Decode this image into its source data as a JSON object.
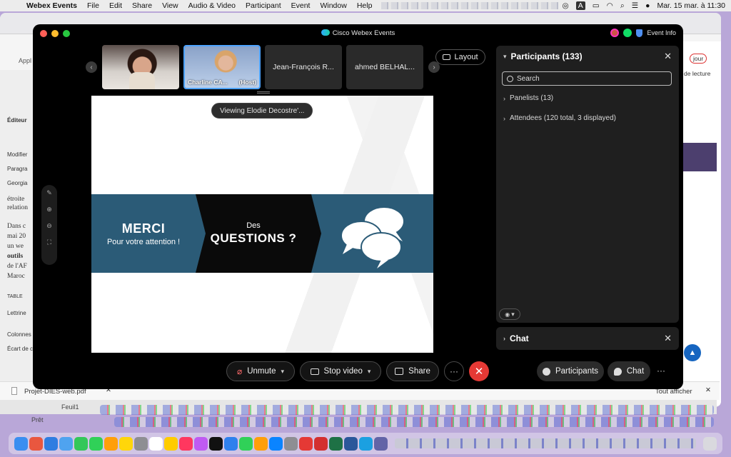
{
  "menubar": {
    "app": "Webex Events",
    "items": [
      "File",
      "Edit",
      "Share",
      "View",
      "Audio & Video",
      "Participant",
      "Event",
      "Window",
      "Help"
    ],
    "clock": "Mar. 15 mar. à 11:30",
    "letter_icon": "A"
  },
  "background": {
    "left_labels": [
      "Éditeur",
      "Modifier",
      "Paragra",
      "Georgia",
      "étroite",
      "relation",
      "Dans c",
      "mai 20",
      "un we",
      "outils",
      "de l'AF",
      "Maroc",
      "TABLE",
      "Lettrine",
      "Colonnes",
      "Écart de co"
    ],
    "app_label": "Appl",
    "right_labels": [
      "jour",
      "de lecture"
    ],
    "sheet_tab": "Feuil1",
    "status": "Prêt",
    "download_file": "Projet-DIES-web.pdf",
    "show_all": "Tout afficher"
  },
  "webex": {
    "title": "Cisco Webex Events",
    "event_info": "Event Info",
    "layout_label": "Layout",
    "thumbnails": [
      {
        "name": "",
        "kind": "video1"
      },
      {
        "name": "Charline CA...",
        "role": "(Host)",
        "kind": "video2"
      },
      {
        "name": "Jean-François R...",
        "kind": "text"
      },
      {
        "name": "ahmed BELHAL...",
        "kind": "text"
      }
    ],
    "viewing": "Viewing Elodie Decostre'...",
    "slide": {
      "merci": "MERCI",
      "merci_sub": "Pour votre attention !",
      "des": "Des",
      "questions": "QUESTIONS ?"
    },
    "controls": {
      "unmute": "Unmute",
      "stop_video": "Stop video",
      "share": "Share",
      "more": "···",
      "end": "✕",
      "participants": "Participants",
      "chat": "Chat",
      "overflow": "···"
    },
    "participants_panel": {
      "title": "Participants (133)",
      "search_placeholder": "Search",
      "panelists": "Panelists (13)",
      "attendees": "Attendees (120 total, 3 displayed)"
    },
    "chat_panel": {
      "title": "Chat"
    }
  },
  "colors": {
    "accent_blue": "#2b5b77",
    "end_red": "#e53935",
    "host_border": "#4da3ff"
  }
}
